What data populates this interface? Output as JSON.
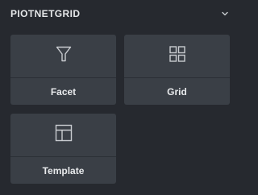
{
  "panel": {
    "title": "PIOTNETGRID",
    "collapse_icon": "chevron-down-icon"
  },
  "widgets": [
    {
      "label": "Facet",
      "icon": "filter-icon"
    },
    {
      "label": "Grid",
      "icon": "grid-icon"
    },
    {
      "label": "Template",
      "icon": "template-layout-icon"
    }
  ],
  "colors": {
    "background": "#26292f",
    "card": "#3a3f46",
    "text": "#e8eaec",
    "icon": "#c9ccd0"
  }
}
